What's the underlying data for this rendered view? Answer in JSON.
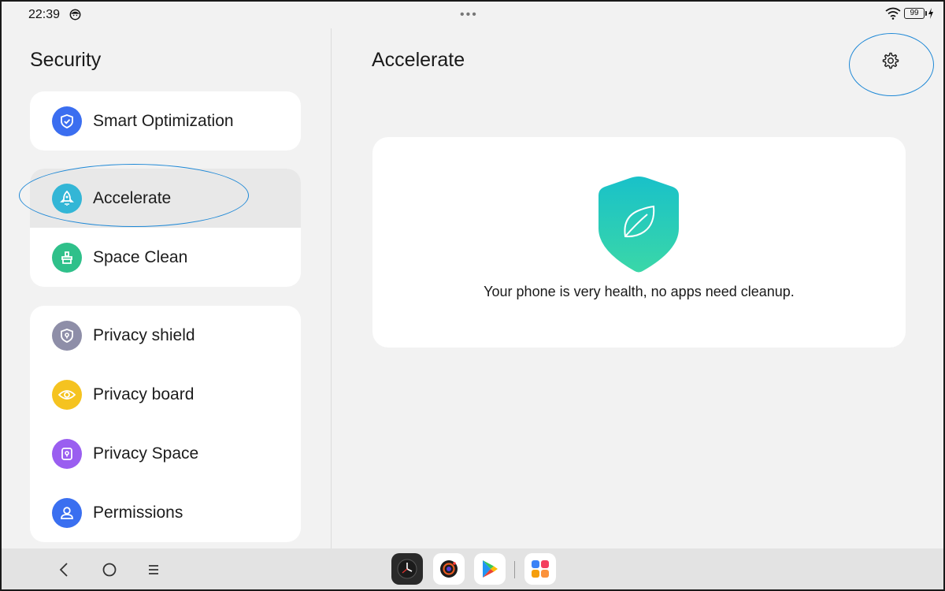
{
  "status_bar": {
    "time": "22:39",
    "battery": "99"
  },
  "sidebar": {
    "title": "Security",
    "groups": [
      {
        "items": [
          {
            "label": "Smart Optimization",
            "icon": "shield-check-icon",
            "color": "#3b6ef0"
          }
        ]
      },
      {
        "items": [
          {
            "label": "Accelerate",
            "icon": "rocket-icon",
            "color": "#33b6d6",
            "selected": true
          },
          {
            "label": "Space Clean",
            "icon": "broom-icon",
            "color": "#2fc08a"
          }
        ]
      },
      {
        "items": [
          {
            "label": "Privacy shield",
            "icon": "privacy-shield-icon",
            "color": "#8e8ea8"
          },
          {
            "label": "Privacy board",
            "icon": "eye-icon",
            "color": "#f5c320"
          },
          {
            "label": "Privacy Space",
            "icon": "lock-box-icon",
            "color": "#9a5ef0"
          },
          {
            "label": "Permissions",
            "icon": "person-icon",
            "color": "#3a6ff0"
          }
        ]
      }
    ]
  },
  "main": {
    "title": "Accelerate",
    "message": "Your phone is very health, no apps need cleanup.",
    "settings_icon": "gear-icon"
  },
  "nav": {
    "back_icon": "back-icon",
    "home_icon": "home-icon",
    "recents_icon": "recents-icon"
  },
  "dock": {
    "apps": [
      "clock-app-icon",
      "camera-app-icon",
      "play-store-icon",
      "app-drawer-icon"
    ]
  },
  "colors": {
    "accent": "#1e88d6",
    "shield_top": "#19c1c9",
    "shield_bottom": "#3ad7a8"
  }
}
